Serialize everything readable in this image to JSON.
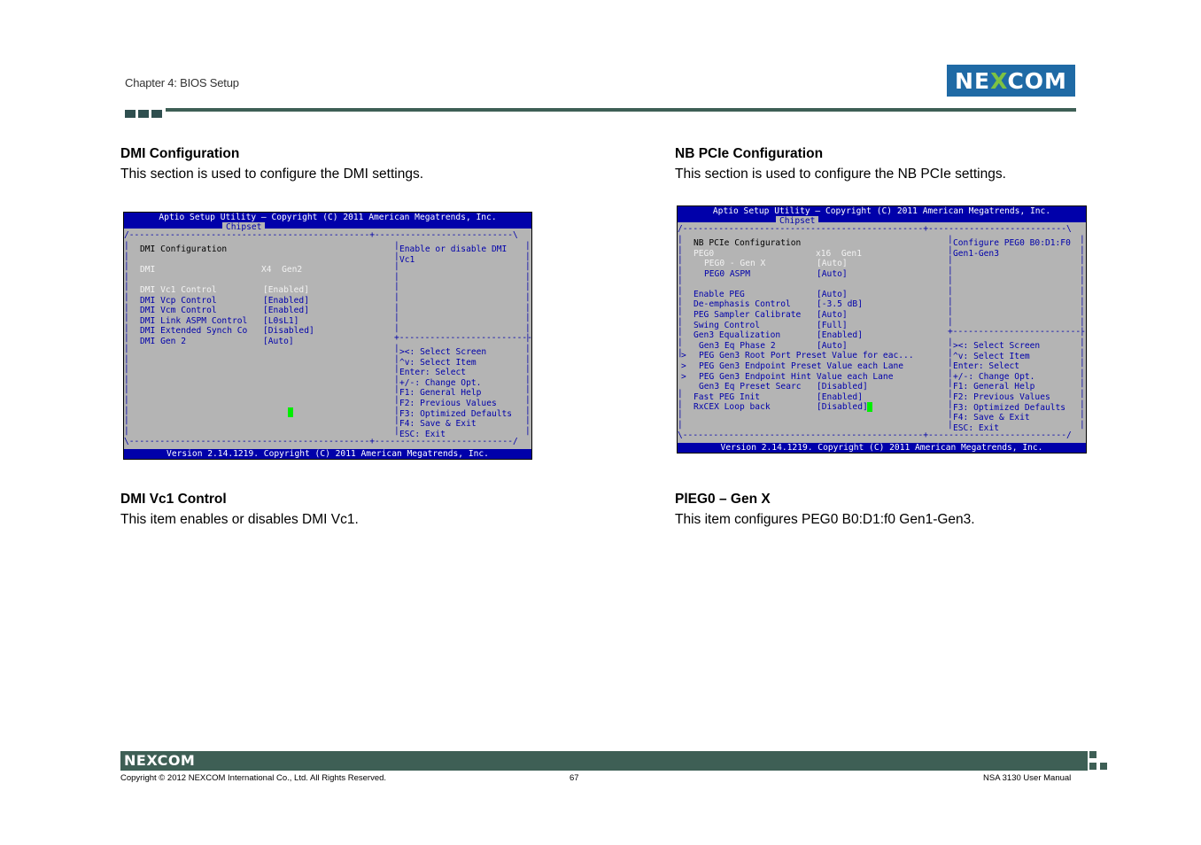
{
  "header": {
    "chapter": "Chapter 4: BIOS Setup",
    "logo_left": "NE",
    "logo_x": "X",
    "logo_right": "COM"
  },
  "left": {
    "heading1": "DMI Configuration",
    "text1": "This section is used to configure the DMI settings.",
    "heading2": "DMI Vc1 Control",
    "text2": "This item enables or disables DMI Vc1.",
    "bios": {
      "title": "Aptio Setup Utility – Copyright (C) 2011 American Megatrends, Inc.",
      "tab": "Chipset",
      "section": "DMI Configuration",
      "info_label": "DMI",
      "info_value": "X4  Gen2",
      "items": [
        {
          "label": "DMI Vc1 Control",
          "value": "[Enabled]"
        },
        {
          "label": "DMI Vcp Control",
          "value": "[Enabled]"
        },
        {
          "label": "DMI Vcm Control",
          "value": "[Enabled]"
        },
        {
          "label": "DMI Link ASPM Control",
          "value": "[L0sL1]"
        },
        {
          "label": "DMI Extended Synch Co",
          "value": "[Disabled]"
        },
        {
          "label": "DMI Gen 2",
          "value": "[Auto]"
        }
      ],
      "help": [
        "Enable or disable DMI",
        "Vc1"
      ],
      "keys": [
        "><: Select Screen",
        "^v: Select Item",
        "Enter: Select",
        "+/-: Change Opt.",
        "F1: General Help",
        "F2: Previous Values",
        "F3: Optimized Defaults",
        "F4: Save & Exit",
        "ESC: Exit"
      ],
      "footer": "Version 2.14.1219. Copyright (C) 2011 American Megatrends, Inc."
    }
  },
  "right": {
    "heading1": "NB PCIe Configuration",
    "text1": "This section is used to configure the NB PCIe settings.",
    "heading2": "PlEG0 – Gen X",
    "text2": "This item configures PEG0 B0:D1:f0 Gen1-Gen3.",
    "bios": {
      "title": "Aptio Setup Utility – Copyright (C) 2011 American Megatrends, Inc.",
      "tab": "Chipset",
      "section": "NB PCIe Configuration",
      "info_label": "PEG0",
      "info_value": "x16  Gen1",
      "items": [
        {
          "prefix": "  ",
          "label": "PEG0 - Gen X",
          "value": "[Auto]",
          "state": "selected"
        },
        {
          "prefix": "  ",
          "label": "PEG0 ASPM",
          "value": "[Auto]",
          "state": "normal"
        },
        {
          "prefix": "",
          "label": "",
          "value": "",
          "state": "blank"
        },
        {
          "prefix": "",
          "label": "Enable PEG",
          "value": "[Auto]",
          "state": "normal"
        },
        {
          "prefix": "",
          "label": "De-emphasis Control",
          "value": "[-3.5 dB]",
          "state": "normal"
        },
        {
          "prefix": "",
          "label": "PEG Sampler Calibrate",
          "value": "[Auto]",
          "state": "normal"
        },
        {
          "prefix": "",
          "label": "Swing Control",
          "value": "[Full]",
          "state": "normal"
        },
        {
          "prefix": "",
          "label": "Gen3 Equalization",
          "value": "[Enabled]",
          "state": "normal"
        },
        {
          "prefix": " ",
          "label": "Gen3 Eq Phase 2",
          "value": "[Auto]",
          "state": "normal"
        },
        {
          "prefix": "> ",
          "label": "PEG Gen3 Root Port Preset Value for eac...",
          "value": "",
          "state": "sub"
        },
        {
          "prefix": "> ",
          "label": "PEG Gen3 Endpoint Preset Value each Lane",
          "value": "",
          "state": "sub"
        },
        {
          "prefix": "> ",
          "label": "PEG Gen3 Endpoint Hint Value each Lane",
          "value": "",
          "state": "sub"
        },
        {
          "prefix": " ",
          "label": "Gen3 Eq Preset Searc",
          "value": "[Disabled]",
          "state": "normal"
        },
        {
          "prefix": "",
          "label": "Fast PEG Init",
          "value": "[Enabled]",
          "state": "normal"
        },
        {
          "prefix": "",
          "label": "RxCEX Loop back",
          "value": "[Disabled]",
          "state": "normal"
        }
      ],
      "help": [
        "Configure PEG0 B0:D1:F0",
        "Gen1-Gen3"
      ],
      "keys": [
        "><: Select Screen",
        "^v: Select Item",
        "Enter: Select",
        "+/-: Change Opt.",
        "F1: General Help",
        "F2: Previous Values",
        "F3: Optimized Defaults",
        "F4: Save & Exit",
        "ESC: Exit"
      ],
      "footer": "Version 2.14.1219. Copyright (C) 2011 American Megatrends, Inc."
    }
  },
  "footer": {
    "logo": "NEXCOM",
    "copyright": "Copyright © 2012 NEXCOM International Co., Ltd. All Rights Reserved.",
    "page": "67",
    "manual": "NSA 3130 User Manual"
  },
  "colors": {
    "bios_blue": "#0000aa",
    "bios_gray": "#b4b4b4",
    "accent_green": "#3e5f55",
    "logo_blue": "#1f6aa5"
  }
}
